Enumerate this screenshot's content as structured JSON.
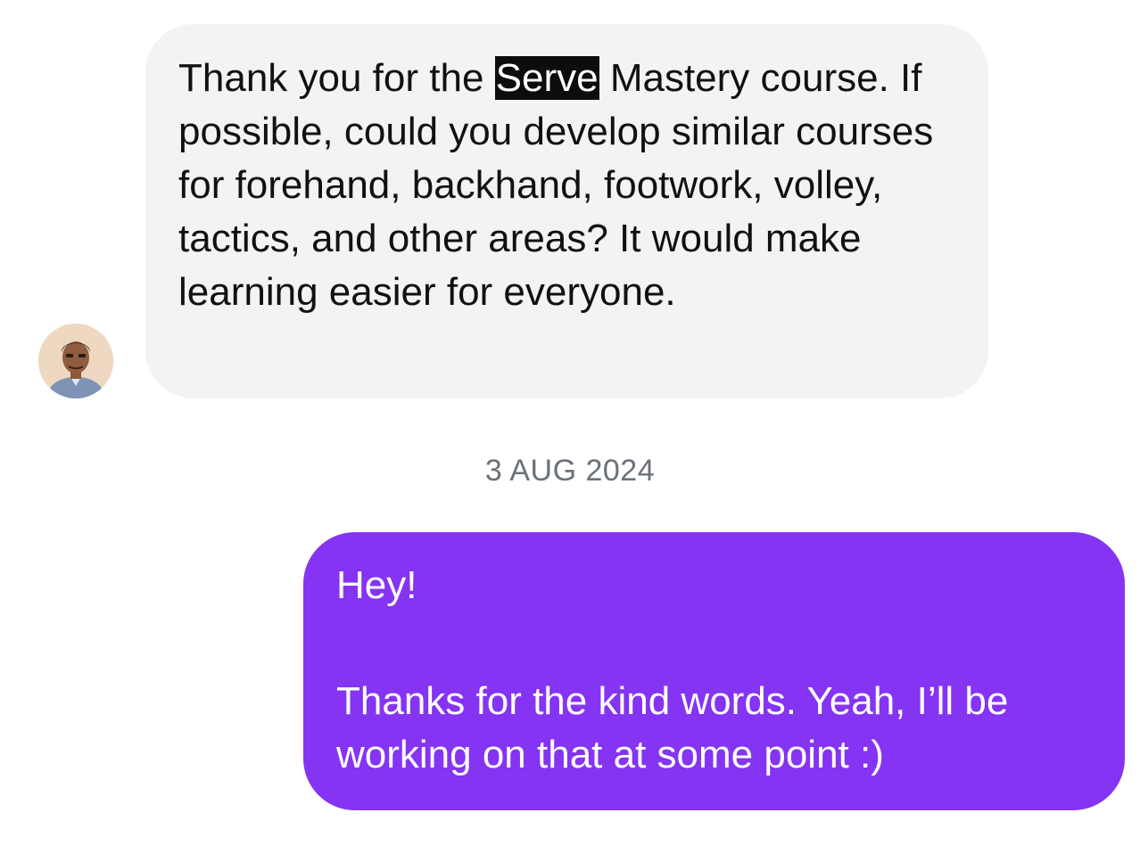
{
  "incoming_message": {
    "text_before": "Thank you for the ",
    "highlighted": "Serve",
    "text_after": " Mastery course. If possible, could you develop similar courses for forehand, backhand, footwork, volley, tactics, and other areas? It would make learning easier for everyone."
  },
  "date_separator": "3 AUG 2024",
  "outgoing_message": {
    "greeting": "Hey!",
    "body": "Thanks for the kind words. Yeah, I’ll be working on that at some point :)"
  },
  "colors": {
    "incoming_bubble": "#f2f3f5",
    "outgoing_bubble": "#8434f2",
    "date_text": "#6b7178",
    "highlight": "#0d0d0d"
  }
}
